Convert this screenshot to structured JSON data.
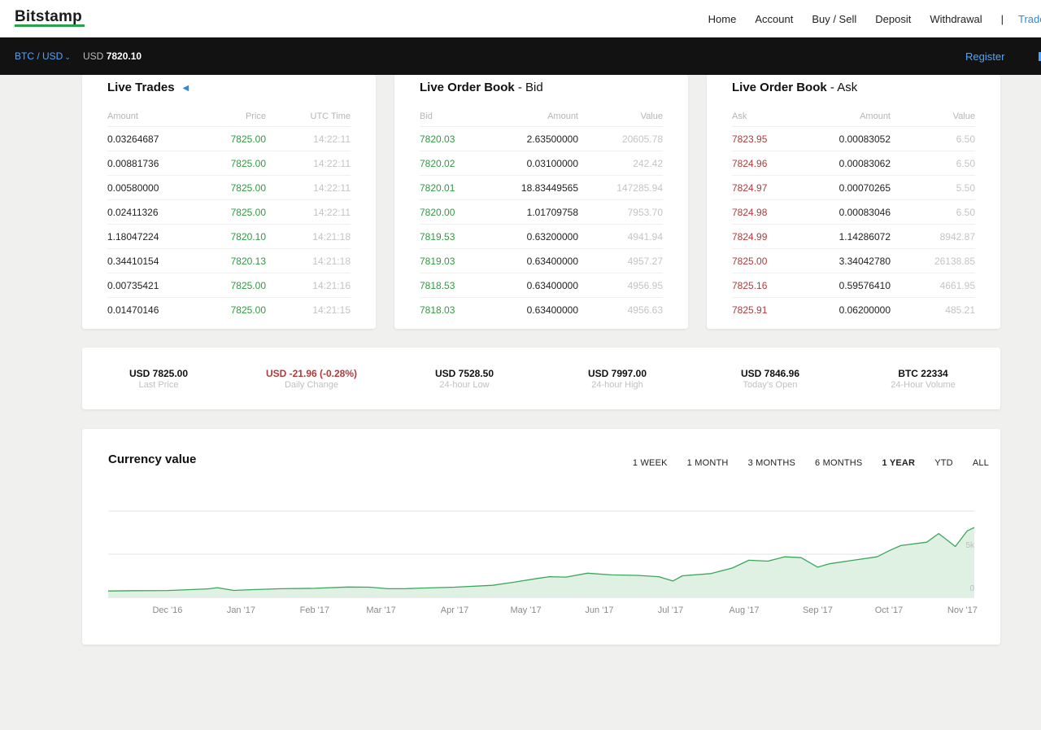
{
  "nav": {
    "logo": "Bitstamp",
    "links": [
      "Home",
      "Account",
      "Buy / Sell",
      "Deposit",
      "Withdrawal"
    ],
    "separator": "|",
    "trade": "Trade"
  },
  "ticker": {
    "pair": "BTC / USD",
    "currency": "USD",
    "price": "7820.10",
    "register": "Register"
  },
  "live_trades": {
    "title": "Live Trades",
    "headers": [
      "Amount",
      "Price",
      "UTC Time"
    ],
    "rows": [
      [
        "0.03264687",
        "7825.00",
        "14:22:11"
      ],
      [
        "0.00881736",
        "7825.00",
        "14:22:11"
      ],
      [
        "0.00580000",
        "7825.00",
        "14:22:11"
      ],
      [
        "0.02411326",
        "7825.00",
        "14:22:11"
      ],
      [
        "1.18047224",
        "7820.10",
        "14:21:18"
      ],
      [
        "0.34410154",
        "7820.13",
        "14:21:18"
      ],
      [
        "0.00735421",
        "7825.00",
        "14:21:16"
      ],
      [
        "0.01470146",
        "7825.00",
        "14:21:15"
      ]
    ]
  },
  "bid_book": {
    "title_bold": "Live Order Book",
    "title_rest": " - Bid",
    "headers": [
      "Bid",
      "Amount",
      "Value"
    ],
    "rows": [
      [
        "7820.03",
        "2.63500000",
        "20605.78"
      ],
      [
        "7820.02",
        "0.03100000",
        "242.42"
      ],
      [
        "7820.01",
        "18.83449565",
        "147285.94"
      ],
      [
        "7820.00",
        "1.01709758",
        "7953.70"
      ],
      [
        "7819.53",
        "0.63200000",
        "4941.94"
      ],
      [
        "7819.03",
        "0.63400000",
        "4957.27"
      ],
      [
        "7818.53",
        "0.63400000",
        "4956.95"
      ],
      [
        "7818.03",
        "0.63400000",
        "4956.63"
      ]
    ]
  },
  "ask_book": {
    "title_bold": "Live Order Book",
    "title_rest": " - Ask",
    "headers": [
      "Ask",
      "Amount",
      "Value"
    ],
    "rows": [
      [
        "7823.95",
        "0.00083052",
        "6.50"
      ],
      [
        "7824.96",
        "0.00083062",
        "6.50"
      ],
      [
        "7824.97",
        "0.00070265",
        "5.50"
      ],
      [
        "7824.98",
        "0.00083046",
        "6.50"
      ],
      [
        "7824.99",
        "1.14286072",
        "8942.87"
      ],
      [
        "7825.00",
        "3.34042780",
        "26138.85"
      ],
      [
        "7825.16",
        "0.59576410",
        "4661.95"
      ],
      [
        "7825.91",
        "0.06200000",
        "485.21"
      ]
    ]
  },
  "stats": [
    {
      "value": "USD 7825.00",
      "label": "Last Price",
      "color": "#111111"
    },
    {
      "value": "USD -21.96 (-0.28%)",
      "label": "Daily Change",
      "color": "#b23a3a"
    },
    {
      "value": "USD 7528.50",
      "label": "24-hour Low",
      "color": "#111111"
    },
    {
      "value": "USD 7997.00",
      "label": "24-hour High",
      "color": "#111111"
    },
    {
      "value": "USD 7846.96",
      "label": "Today's Open",
      "color": "#111111"
    },
    {
      "value": "BTC 22334",
      "label": "24-Hour Volume",
      "color": "#111111"
    }
  ],
  "chart": {
    "title": "Currency value",
    "ranges": [
      "1 WEEK",
      "1 MONTH",
      "3 MONTHS",
      "6 MONTHS",
      "1 YEAR",
      "YTD",
      "ALL"
    ],
    "active_range": "1 YEAR"
  },
  "chart_data": {
    "type": "area",
    "title": "Currency value",
    "xlabel": "",
    "ylabel": "",
    "x_tick_labels": [
      "Dec '16",
      "Jan '17",
      "Feb '17",
      "Mar '17",
      "Apr '17",
      "May '17",
      "Jun '17",
      "Jul '17",
      "Aug '17",
      "Sep '17",
      "Oct '17",
      "Nov '17"
    ],
    "y_tick_labels": [
      "0",
      "5k"
    ],
    "ylim": [
      0,
      10000
    ],
    "grid": true,
    "line_color": "#3aa75a",
    "fill_color": "#dff1e3",
    "x": [
      "2016-11-20",
      "2016-12-01",
      "2016-12-15",
      "2017-01-01",
      "2017-01-05",
      "2017-01-12",
      "2017-01-20",
      "2017-02-01",
      "2017-02-15",
      "2017-03-01",
      "2017-03-10",
      "2017-03-18",
      "2017-03-25",
      "2017-04-01",
      "2017-04-15",
      "2017-05-01",
      "2017-05-10",
      "2017-05-20",
      "2017-05-25",
      "2017-06-01",
      "2017-06-10",
      "2017-06-20",
      "2017-07-01",
      "2017-07-10",
      "2017-07-16",
      "2017-07-20",
      "2017-08-01",
      "2017-08-10",
      "2017-08-17",
      "2017-08-25",
      "2017-09-01",
      "2017-09-08",
      "2017-09-15",
      "2017-09-20",
      "2017-09-30",
      "2017-10-10",
      "2017-10-15",
      "2017-10-20",
      "2017-10-31",
      "2017-11-05",
      "2017-11-12",
      "2017-11-17",
      "2017-11-20"
    ],
    "y": [
      740,
      770,
      790,
      980,
      1120,
      800,
      900,
      1000,
      1050,
      1200,
      1180,
      1000,
      1000,
      1080,
      1180,
      1400,
      1750,
      2200,
      2400,
      2350,
      2800,
      2600,
      2550,
      2400,
      1900,
      2500,
      2750,
      3400,
      4300,
      4200,
      4700,
      4600,
      3500,
      3900,
      4300,
      4700,
      5400,
      6000,
      6400,
      7400,
      5900,
      7700,
      8100
    ]
  }
}
